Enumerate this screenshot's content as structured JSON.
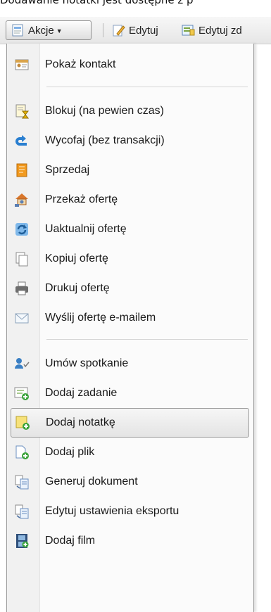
{
  "top_text": "Dodawanie notatki jest dostępne z p",
  "toolbar": {
    "actions_label": "Akcje",
    "actions_icon": "form-icon",
    "edit_label": "Edytuj",
    "edit_icon": "pencil-doc-icon",
    "edit2_label": "Edytuj zd"
  },
  "menu": {
    "items": [
      {
        "label": "Pokaż kontakt",
        "icon": "contact-card-icon"
      },
      {
        "label": "Blokuj (na pewien czas)",
        "icon": "hourglass-doc-icon"
      },
      {
        "label": "Wycofaj (bez transakcji)",
        "icon": "undo-arrow-icon"
      },
      {
        "label": "Sprzedaj",
        "icon": "sell-doc-icon"
      },
      {
        "label": "Przekaż ofertę",
        "icon": "handover-house-icon"
      },
      {
        "label": "Uaktualnij ofertę",
        "icon": "refresh-icon"
      },
      {
        "label": "Kopiuj ofertę",
        "icon": "copy-icon"
      },
      {
        "label": "Drukuj ofertę",
        "icon": "printer-icon"
      },
      {
        "label": "Wyślij ofertę e-mailem",
        "icon": "envelope-icon"
      },
      {
        "label": "Umów spotkanie",
        "icon": "meeting-icon"
      },
      {
        "label": "Dodaj zadanie",
        "icon": "add-task-icon"
      },
      {
        "label": "Dodaj notatkę",
        "icon": "add-note-icon"
      },
      {
        "label": "Dodaj plik",
        "icon": "add-file-icon"
      },
      {
        "label": "Generuj dokument",
        "icon": "generate-doc-icon"
      },
      {
        "label": "Edytuj ustawienia eksportu",
        "icon": "export-settings-icon"
      },
      {
        "label": "Dodaj film",
        "icon": "film-icon"
      }
    ],
    "highlighted": "Dodaj notatkę"
  },
  "colors": {
    "highlight_bg": "#e8e8e8",
    "icon_blue": "#2a7fd0",
    "icon_orange": "#f29a1f",
    "icon_green": "#3aa33a"
  }
}
